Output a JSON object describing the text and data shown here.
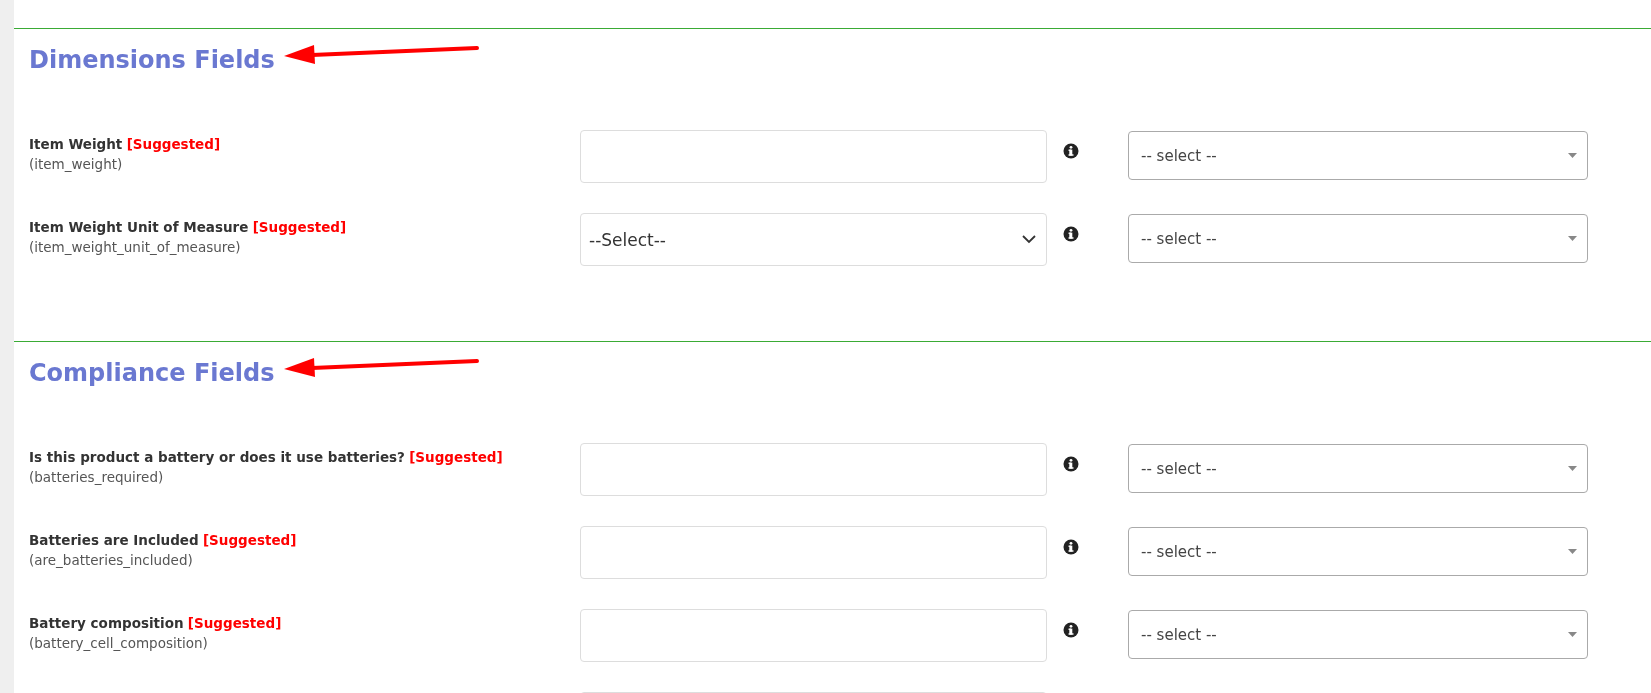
{
  "sections": [
    {
      "title": "Dimensions Fields",
      "annotated": true,
      "rows": [
        {
          "kind": "field",
          "label": "Item Weight",
          "badge": "[Suggested]",
          "field_name": "(item_weight)",
          "input": {
            "kind": "text"
          },
          "mapping": {
            "value": "-- select --"
          }
        },
        {
          "kind": "field",
          "label": "Item Weight Unit of Measure",
          "badge": "[Suggested]",
          "field_name": "(item_weight_unit_of_measure)",
          "input": {
            "kind": "select",
            "value": "--Select--"
          },
          "mapping": {
            "value": "-- select --"
          }
        }
      ]
    },
    {
      "title": "Compliance Fields",
      "annotated": true,
      "rows": [
        {
          "kind": "field",
          "label": "Is this product a battery or does it use batteries?",
          "badge": "[Suggested]",
          "field_name": "(batteries_required)",
          "input": {
            "kind": "text"
          },
          "mapping": {
            "value": "-- select --"
          }
        },
        {
          "kind": "field",
          "label": "Batteries are Included",
          "badge": "[Suggested]",
          "field_name": "(are_batteries_included)",
          "input": {
            "kind": "text"
          },
          "mapping": {
            "value": "-- select --"
          }
        },
        {
          "kind": "field",
          "label": "Battery composition",
          "badge": "[Suggested]",
          "field_name": "(battery_cell_composition)",
          "input": {
            "kind": "text"
          },
          "mapping": {
            "value": "-- select --"
          }
        },
        {
          "kind": "cut",
          "input": {
            "kind": "text"
          }
        }
      ]
    }
  ]
}
